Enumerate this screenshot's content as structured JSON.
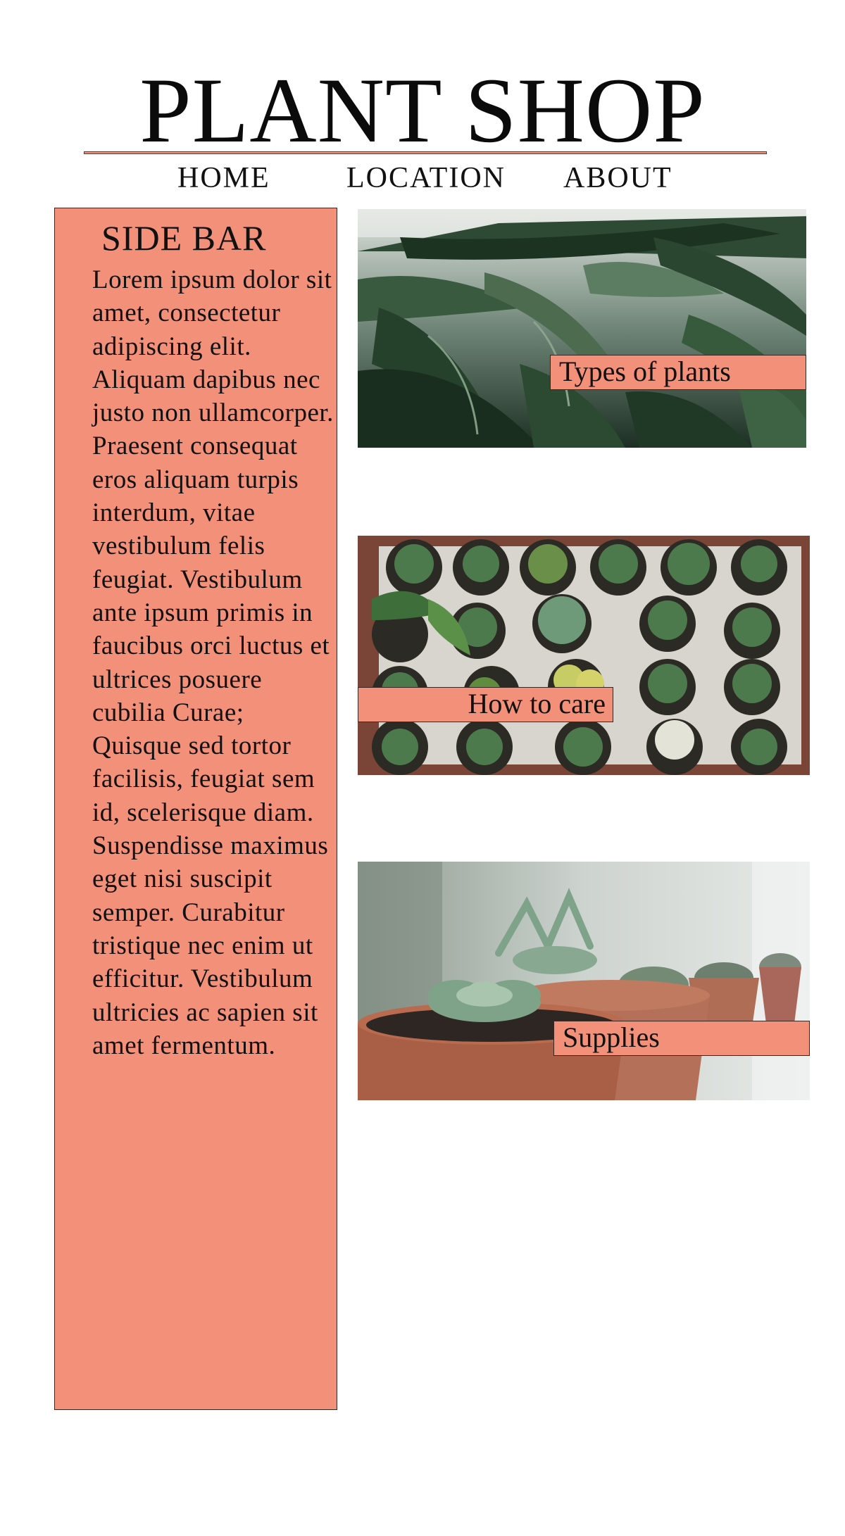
{
  "header": {
    "logo": "PLANT SHOP"
  },
  "nav": {
    "items": [
      {
        "label": "HOME"
      },
      {
        "label": "LOCATION"
      },
      {
        "label": "ABOUT"
      }
    ]
  },
  "sidebar": {
    "title": "SIDE BAR",
    "body": "Lorem ipsum dolor sit amet, consectetur adipiscing elit. Aliquam dapibus nec justo non ullamcorper. Praesent consequat eros aliquam turpis interdum, vitae vestibulum felis feugiat. Vestibulum ante ipsum primis in faucibus orci luctus et ultrices posuere cubilia Curae; Quisque sed tortor facilisis, feugiat sem id, scelerisque diam. Suspendisse maximus eget nisi suscipit semper. Curabitur tristique nec enim ut efficitur. Vestibulum ultricies ac sapien sit amet fermentum."
  },
  "cards": [
    {
      "label": "Types of plants",
      "image": "palm-leaves-photo"
    },
    {
      "label": "How to care",
      "image": "potted-cacti-tray-photo"
    },
    {
      "label": "Supplies",
      "image": "succulents-in-terracotta-pots-photo"
    }
  ],
  "colors": {
    "accent": "#f3907a",
    "border": "#3a2520",
    "text": "#111111",
    "background": "#ffffff"
  }
}
